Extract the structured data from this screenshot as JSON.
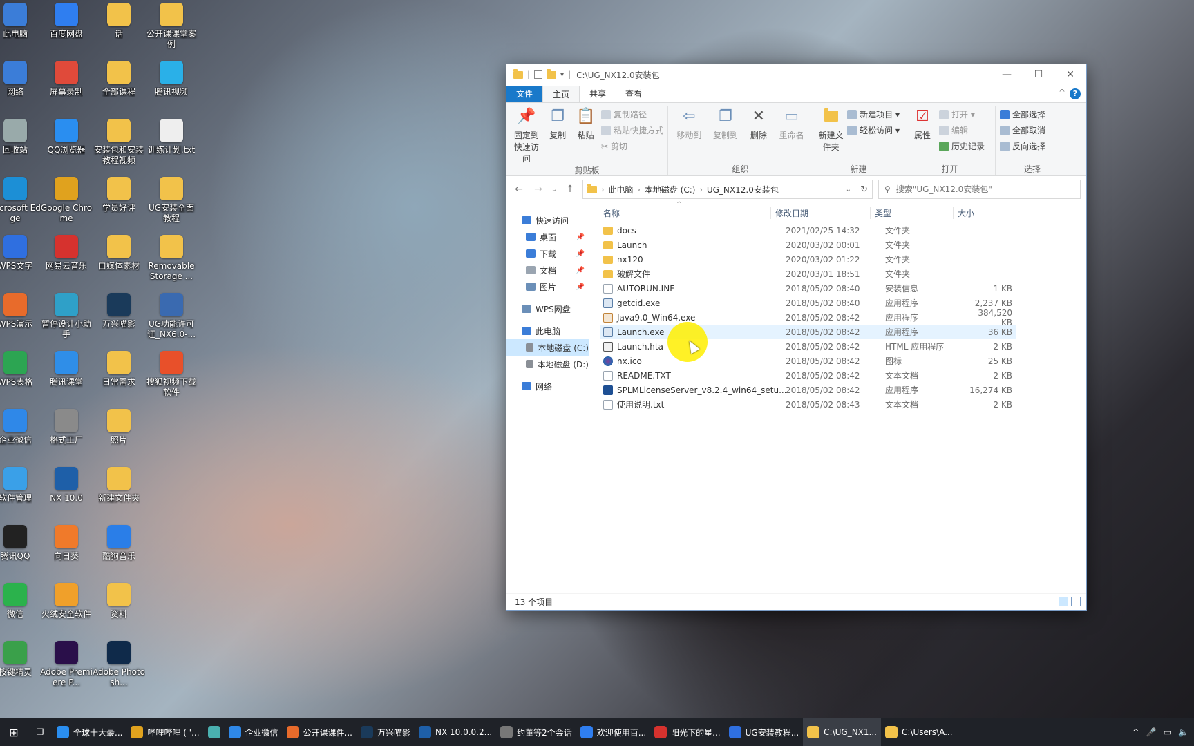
{
  "colors": {
    "accent": "#1979ca",
    "folder": "#f2c24a",
    "selection": "#cce8ff",
    "cursor_highlight": "#fff200"
  },
  "desktop_icons": [
    {
      "label": "此电脑",
      "icon": "computer-icon",
      "color": "#3b7dd8"
    },
    {
      "label": "网络",
      "icon": "network-icon",
      "color": "#3b7dd8"
    },
    {
      "label": "回收站",
      "icon": "recycle-bin-icon",
      "color": "#9aa"
    },
    {
      "label": "Microsoft Edge",
      "icon": "edge-icon",
      "color": "#1c8fd6"
    },
    {
      "label": "WPS文字",
      "icon": "wps-writer-icon",
      "color": "#2f6fe0"
    },
    {
      "label": "WPS演示",
      "icon": "wps-presentation-icon",
      "color": "#e86b2b"
    },
    {
      "label": "WPS表格",
      "icon": "wps-sheet-icon",
      "color": "#2ca552"
    },
    {
      "label": "企业微信",
      "icon": "wecom-icon",
      "color": "#2f88e8"
    },
    {
      "label": "软件管理",
      "icon": "software-manager-icon",
      "color": "#3aa0e8"
    },
    {
      "label": "腾讯QQ",
      "icon": "qq-icon",
      "color": "#222"
    },
    {
      "label": "微信",
      "icon": "wechat-icon",
      "color": "#2bb24c"
    },
    {
      "label": "按键精灵",
      "icon": "script-tool-icon",
      "color": "#3aa04a"
    },
    {
      "label": "百度网盘",
      "icon": "baidu-netdisk-icon",
      "color": "#2f7ef0"
    },
    {
      "label": "屏幕录制",
      "icon": "screen-record-icon",
      "color": "#e04a3a"
    },
    {
      "label": "QQ浏览器",
      "icon": "qq-browser-icon",
      "color": "#2a8ef0"
    },
    {
      "label": "Google Chrome",
      "icon": "chrome-icon",
      "color": "#e0a21e"
    },
    {
      "label": "网易云音乐",
      "icon": "netease-music-icon",
      "color": "#d6322e"
    },
    {
      "label": "暂停设计小助手",
      "icon": "assistant-icon",
      "color": "#2fa0c8"
    },
    {
      "label": "腾讯课堂",
      "icon": "tencent-class-icon",
      "color": "#2f8ee8"
    },
    {
      "label": "格式工厂",
      "icon": "format-factory-icon",
      "color": "#8a8a8a"
    },
    {
      "label": "NX 10.0",
      "icon": "nx-icon",
      "color": "#1e5fa8"
    },
    {
      "label": "向日葵",
      "icon": "sunflower-icon",
      "color": "#f07a2a"
    },
    {
      "label": "火绒安全软件",
      "icon": "huorong-icon",
      "color": "#f0a02a"
    },
    {
      "label": "Adobe Premiere P...",
      "icon": "premiere-icon",
      "color": "#2a0f4a"
    },
    {
      "label": "话",
      "icon": "folder-icon",
      "color": "#f2c24a"
    },
    {
      "label": "全部课程",
      "icon": "folder-icon",
      "color": "#f2c24a"
    },
    {
      "label": "安装包和安装教程视频",
      "icon": "folder-icon",
      "color": "#f2c24a"
    },
    {
      "label": "学员好评",
      "icon": "folder-icon",
      "color": "#f2c24a"
    },
    {
      "label": "自媒体素材",
      "icon": "folder-icon",
      "color": "#f2c24a"
    },
    {
      "label": "万兴喵影",
      "icon": "filmora-icon",
      "color": "#1a3a5a"
    },
    {
      "label": "日常需求",
      "icon": "folder-icon",
      "color": "#f2c24a"
    },
    {
      "label": "照片",
      "icon": "folder-icon",
      "color": "#f2c24a"
    },
    {
      "label": "新建文件夹",
      "icon": "folder-icon",
      "color": "#f2c24a"
    },
    {
      "label": "酷狗音乐",
      "icon": "kugou-icon",
      "color": "#2a7ee8"
    },
    {
      "label": "资料",
      "icon": "folder-icon",
      "color": "#f2c24a"
    },
    {
      "label": "Adobe Photosh...",
      "icon": "photoshop-icon",
      "color": "#0f2a4a"
    },
    {
      "label": "公开课课堂案例",
      "icon": "folder-icon",
      "color": "#f2c24a"
    },
    {
      "label": "腾讯视频",
      "icon": "tencent-video-icon",
      "color": "#2ab0e8"
    },
    {
      "label": "训练计划.txt",
      "icon": "text-file-icon",
      "color": "#eeeeee"
    },
    {
      "label": "UG安装全面教程",
      "icon": "folder-icon",
      "color": "#f2c24a"
    },
    {
      "label": "Removable Storage ...",
      "icon": "folder-icon",
      "color": "#f2c24a"
    },
    {
      "label": "UG功能许可证_NX6.0-...",
      "icon": "license-icon",
      "color": "#3a6ab0"
    },
    {
      "label": "搜狐视频下载软件",
      "icon": "video-download-icon",
      "color": "#e8502a"
    }
  ],
  "window": {
    "title": "C:\\UG_NX12.0安装包",
    "tabs": [
      "文件",
      "主页",
      "共享",
      "查看"
    ],
    "ribbon": {
      "clipboard": {
        "name": "剪贴板",
        "pin": "固定到快速访问",
        "copy": "复制",
        "paste": "粘贴",
        "copy_path": "复制路径",
        "paste_shortcut": "粘贴快捷方式",
        "cut": "剪切"
      },
      "organize": {
        "name": "组织",
        "move_to": "移动到",
        "copy_to": "复制到",
        "delete": "删除",
        "rename": "重命名"
      },
      "new": {
        "name": "新建",
        "new_folder": "新建文件夹",
        "new_item": "新建项目 ▾",
        "easy_access": "轻松访问 ▾"
      },
      "open": {
        "name": "打开",
        "properties": "属性",
        "open": "打开 ▾",
        "edit": "编辑",
        "history": "历史记录"
      },
      "select": {
        "name": "选择",
        "select_all": "全部选择",
        "select_none": "全部取消",
        "invert": "反向选择"
      }
    },
    "address": {
      "crumbs": [
        "此电脑",
        "本地磁盘 (C:)",
        "UG_NX12.0安装包"
      ]
    },
    "search": {
      "placeholder": "搜索\"UG_NX12.0安装包\""
    },
    "sidebar": [
      {
        "label": "快速访问",
        "icon": "star-icon",
        "pinned": false,
        "sub": false
      },
      {
        "label": "桌面",
        "icon": "desktop-icon",
        "pinned": true,
        "sub": true
      },
      {
        "label": "下载",
        "icon": "download-icon",
        "pinned": true,
        "sub": true
      },
      {
        "label": "文档",
        "icon": "document-icon",
        "pinned": true,
        "sub": true
      },
      {
        "label": "图片",
        "icon": "picture-icon",
        "pinned": true,
        "sub": true
      },
      {
        "label": "WPS网盘",
        "icon": "cloud-icon",
        "pinned": false,
        "sub": false
      },
      {
        "label": "此电脑",
        "icon": "computer-icon",
        "pinned": false,
        "sub": false
      },
      {
        "label": "本地磁盘 (C:)",
        "icon": "drive-icon",
        "pinned": false,
        "sub": true,
        "selected": true
      },
      {
        "label": "本地磁盘 (D:)",
        "icon": "drive-icon",
        "pinned": false,
        "sub": true
      },
      {
        "label": "网络",
        "icon": "network-icon",
        "pinned": false,
        "sub": false
      }
    ],
    "columns": {
      "name": "名称",
      "date": "修改日期",
      "type": "类型",
      "size": "大小"
    },
    "files": [
      {
        "name": "docs",
        "date": "2021/02/25 14:32",
        "type": "文件夹",
        "size": "",
        "kind": "folder"
      },
      {
        "name": "Launch",
        "date": "2020/03/02 00:01",
        "type": "文件夹",
        "size": "",
        "kind": "folder"
      },
      {
        "name": "nx120",
        "date": "2020/03/02 01:22",
        "type": "文件夹",
        "size": "",
        "kind": "folder"
      },
      {
        "name": "破解文件",
        "date": "2020/03/01 18:51",
        "type": "文件夹",
        "size": "",
        "kind": "folder"
      },
      {
        "name": "AUTORUN.INF",
        "date": "2018/05/02 08:40",
        "type": "安装信息",
        "size": "1 KB",
        "kind": "file"
      },
      {
        "name": "getcid.exe",
        "date": "2018/05/02 08:40",
        "type": "应用程序",
        "size": "2,237 KB",
        "kind": "exe"
      },
      {
        "name": "Java9.0_Win64.exe",
        "date": "2018/05/02 08:42",
        "type": "应用程序",
        "size": "384,520 KB",
        "kind": "java"
      },
      {
        "name": "Launch.exe",
        "date": "2018/05/02 08:42",
        "type": "应用程序",
        "size": "36 KB",
        "kind": "exe",
        "hover": true
      },
      {
        "name": "Launch.hta",
        "date": "2018/05/02 08:42",
        "type": "HTML 应用程序",
        "size": "2 KB",
        "kind": "hta"
      },
      {
        "name": "nx.ico",
        "date": "2018/05/02 08:42",
        "type": "图标",
        "size": "25 KB",
        "kind": "ico"
      },
      {
        "name": "README.TXT",
        "date": "2018/05/02 08:42",
        "type": "文本文档",
        "size": "2 KB",
        "kind": "file"
      },
      {
        "name": "SPLMLicenseServer_v8.2.4_win64_setu...",
        "date": "2018/05/02 08:42",
        "type": "应用程序",
        "size": "16,274 KB",
        "kind": "splm"
      },
      {
        "name": "使用说明.txt",
        "date": "2018/05/02 08:43",
        "type": "文本文档",
        "size": "2 KB",
        "kind": "file"
      }
    ],
    "status": "13 个项目"
  },
  "taskbar": [
    {
      "label": "全球十大最...",
      "icon": "search-icon",
      "color": "#2a8ef0"
    },
    {
      "label": "哔哩哔哩 ( '...",
      "icon": "chrome-icon",
      "color": "#e0a21e"
    },
    {
      "label": "",
      "icon": "app-icon",
      "color": "#4ab0b0"
    },
    {
      "label": "企业微信",
      "icon": "wecom-icon",
      "color": "#2f88e8"
    },
    {
      "label": "公开课课件...",
      "icon": "wps-presentation-icon",
      "color": "#e86b2b"
    },
    {
      "label": "万兴喵影",
      "icon": "filmora-icon",
      "color": "#1a3a5a"
    },
    {
      "label": "NX 10.0.0.2...",
      "icon": "nx-icon",
      "color": "#1e5fa8"
    },
    {
      "label": "约董等2个会话",
      "icon": "chat-icon",
      "color": "#777777"
    },
    {
      "label": "欢迎使用百...",
      "icon": "baidu-netdisk-icon",
      "color": "#2f7ef0"
    },
    {
      "label": "阳光下的星...",
      "icon": "netease-music-icon",
      "color": "#d6322e"
    },
    {
      "label": "UG安装教程...",
      "icon": "wps-writer-icon",
      "color": "#2f6fe0"
    },
    {
      "label": "C:\\UG_NX1...",
      "icon": "folder-icon",
      "color": "#f2c24a",
      "active": true
    },
    {
      "label": "C:\\Users\\A...",
      "icon": "folder-icon",
      "color": "#f2c24a"
    }
  ]
}
